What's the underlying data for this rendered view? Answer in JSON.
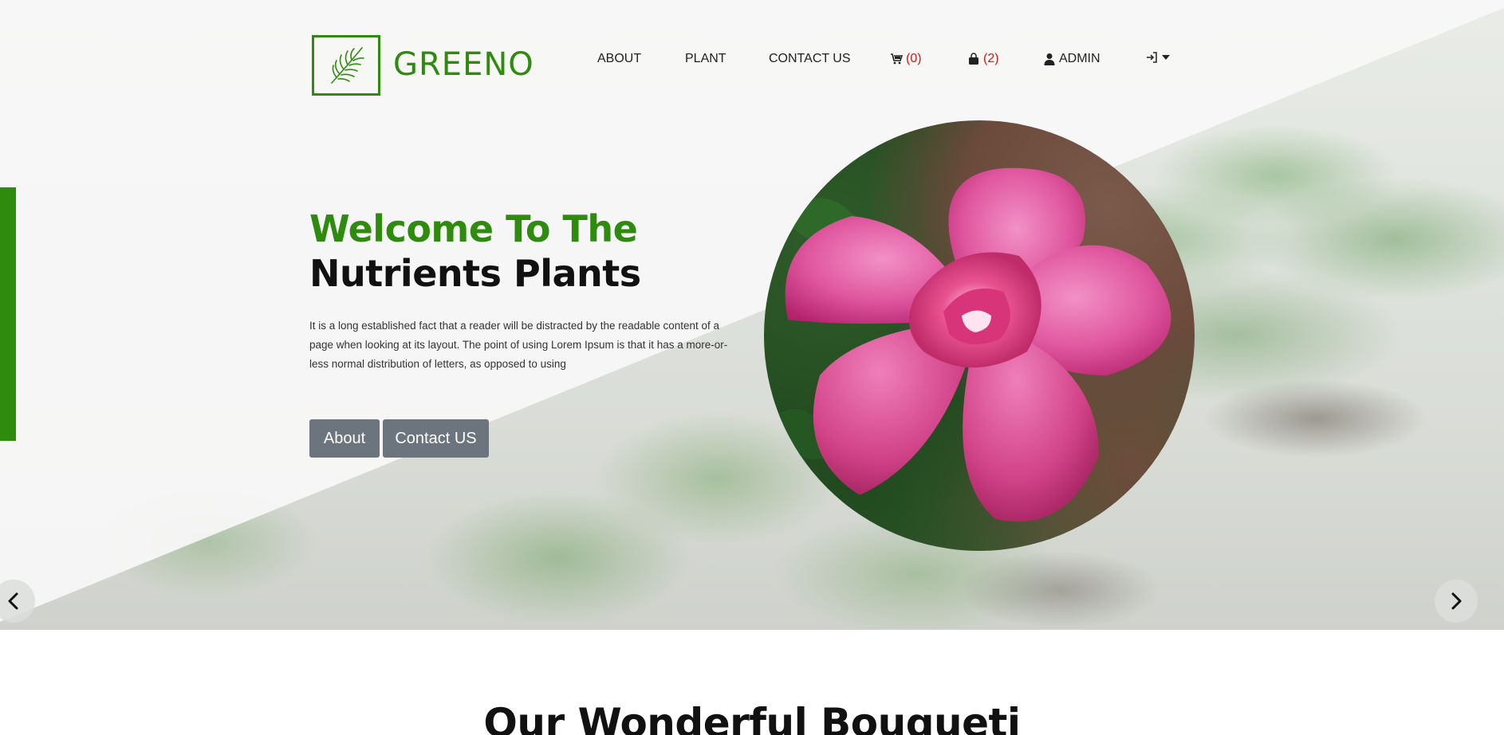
{
  "header": {
    "logo_text": "GREENO",
    "nav": {
      "about": "ABOUT",
      "plant": "PLANT",
      "contact": "CONTACT US",
      "cart_count": "(0)",
      "bag_count": "(2)",
      "admin": "ADMIN"
    },
    "icons": [
      "leaf-icon",
      "cart-icon",
      "shopping-bag-icon",
      "user-icon",
      "sign-in-icon",
      "caret-down-icon"
    ]
  },
  "hero": {
    "title_line1": "Welcome To The",
    "title_line2": "Nutrients Plants",
    "description": "It is a long established fact that a reader will be distracted by the readable content of a page when looking at its layout. The point of using Lorem Ipsum is that it has a more-or-less normal distribution of letters, as opposed to using",
    "about_button": "About",
    "contact_button": "Contact US"
  },
  "section": {
    "title": "Our Wonderful Bouqueti"
  },
  "colors": {
    "brand_green": "#2e8b0e",
    "badge_red": "#d71515",
    "button_gray": "#6c757d"
  }
}
